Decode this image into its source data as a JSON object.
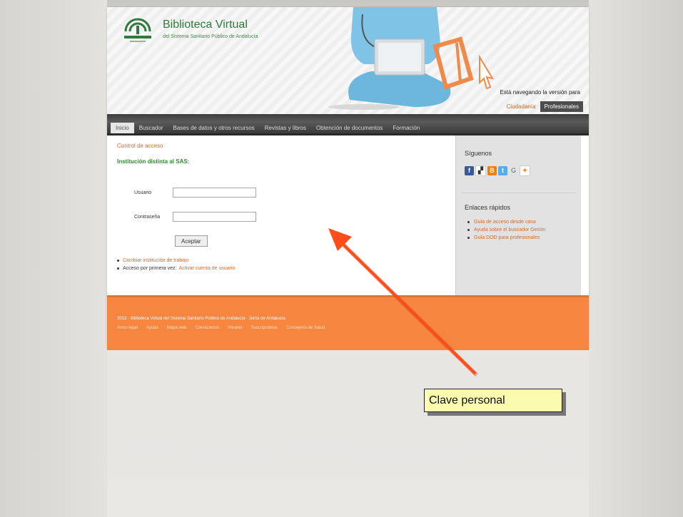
{
  "header": {
    "brand_title": "Biblioteca Virtual",
    "brand_subtitle": "del Sistema Sanitario Público de Andalucía",
    "browsing_text": "Está navegando la versión para",
    "version_options": [
      {
        "label": "Ciudadanía",
        "active": false
      },
      {
        "label": "Profesionales",
        "active": true
      }
    ]
  },
  "nav": {
    "items": [
      {
        "label": "Inicio",
        "active": true
      },
      {
        "label": "Buscador",
        "active": false
      },
      {
        "label": "Bases de datos y otros recursos",
        "active": false
      },
      {
        "label": "Revistas y libros",
        "active": false
      },
      {
        "label": "Obtención de documentos",
        "active": false
      },
      {
        "label": "Formación",
        "active": false
      }
    ]
  },
  "login": {
    "breadcrumb": "Control de acceso",
    "institution_title": "Institución distinta al SAS:",
    "username_label": "Usuario",
    "username_value": "",
    "password_label": "Contraseña",
    "password_value": "",
    "submit_label": "Aceptar",
    "links": [
      {
        "prefix": "",
        "text": "Cambiar institución de trabajo"
      },
      {
        "prefix": "Acceso por primera vez:",
        "text": "Activar cuenta de usuario"
      }
    ]
  },
  "sidebar": {
    "follow_title": "Síguenos",
    "social_icons": [
      "facebook-icon",
      "delicious-icon",
      "blogger-icon",
      "twitter-icon",
      "google-icon",
      "rss-icon"
    ],
    "quick_links_title": "Enlaces rápidos",
    "quick_links": [
      "Guía de acceso desde casa",
      "Ayuda sobre el buscador Gerión",
      "Guía DOD para profesionales"
    ]
  },
  "footer": {
    "copyright": "2013 - Biblioteca Virtual del Sistema Sanitario Público de Andalucía - Junta de Andalucía",
    "links": [
      "Aviso legal",
      "Ayuda",
      "Mapa web",
      "Contáctenos",
      "Intranet",
      "Suscripciones",
      "Consejería de Salud"
    ]
  },
  "annotation": {
    "callout_text": "Clave personal",
    "arrow_color": "#ff4d1a"
  },
  "colors": {
    "brand_green": "#2f7a3c",
    "accent_orange": "#d36b2b",
    "footer_orange": "#f5853f"
  }
}
